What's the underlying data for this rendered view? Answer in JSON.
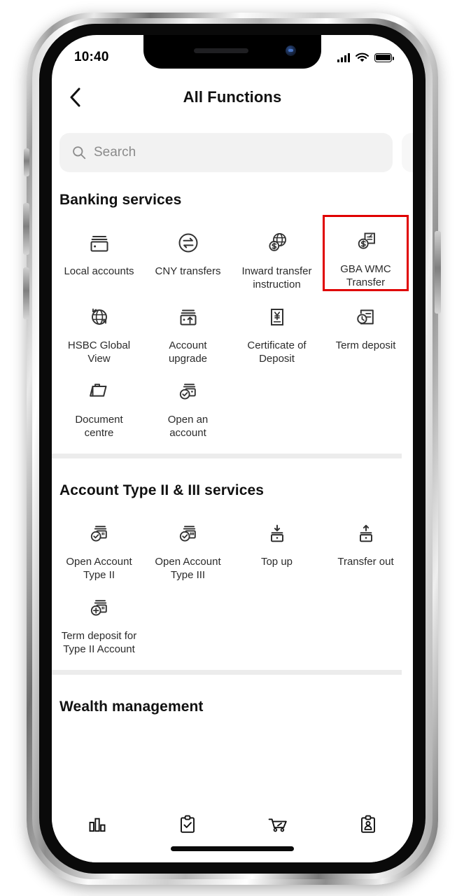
{
  "status_bar": {
    "time": "10:40",
    "signal_icon": "signal-bars-icon",
    "wifi_icon": "wifi-icon",
    "battery_icon": "battery-full-icon"
  },
  "header": {
    "back_icon": "back-chevron-icon",
    "title": "All Functions"
  },
  "search": {
    "icon": "search-icon",
    "placeholder": "Search",
    "value": ""
  },
  "highlight": {
    "color": "#e00000",
    "target": "GBA WMC Transfer"
  },
  "sections": [
    {
      "title": "Banking services",
      "items": [
        {
          "label": "Local accounts",
          "icon": "wallet-icon"
        },
        {
          "label": "CNY transfers",
          "icon": "exchange-circle-icon"
        },
        {
          "label": "Inward transfer instruction",
          "icon": "globe-currency-icon"
        },
        {
          "label": "GBA WMC Transfer",
          "icon": "document-currency-icon",
          "highlighted": true
        },
        {
          "label": "HSBC Global View",
          "icon": "globe-refresh-icon"
        },
        {
          "label": "Account upgrade",
          "icon": "wallet-up-arrow-icon"
        },
        {
          "label": "Certificate of Deposit",
          "icon": "yen-document-icon"
        },
        {
          "label": "Term deposit",
          "icon": "clock-document-icon"
        },
        {
          "label": "Document centre",
          "icon": "folder-icon"
        },
        {
          "label": "Open an account",
          "icon": "wallet-check-icon"
        }
      ]
    },
    {
      "title": "Account Type II & III services",
      "items": [
        {
          "label": "Open Account Type II",
          "icon": "wallet-check-two-icon"
        },
        {
          "label": "Open Account Type III",
          "icon": "wallet-check-three-icon"
        },
        {
          "label": "Top up",
          "icon": "wallet-download-icon"
        },
        {
          "label": "Transfer out",
          "icon": "wallet-upload-icon"
        },
        {
          "label": "Term deposit for Type II Account",
          "icon": "wallet-plus-icon"
        }
      ]
    },
    {
      "title": "Wealth management",
      "items": []
    }
  ],
  "tabbar": {
    "tabs": [
      {
        "icon": "bar-chart-icon",
        "name": "tab-insights"
      },
      {
        "icon": "clipboard-check-icon",
        "name": "tab-tasks"
      },
      {
        "icon": "shopping-cart-icon",
        "name": "tab-shop"
      },
      {
        "icon": "clipboard-person-icon",
        "name": "tab-profile"
      }
    ]
  }
}
